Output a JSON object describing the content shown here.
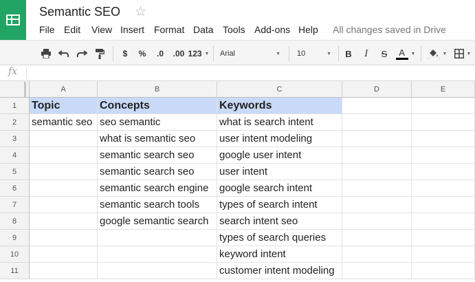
{
  "app": {
    "doc_title": "Semantic SEO",
    "save_status": "All changes saved in Drive",
    "brand_color": "#21a464"
  },
  "menu": [
    "File",
    "Edit",
    "View",
    "Insert",
    "Format",
    "Data",
    "Tools",
    "Add-ons",
    "Help"
  ],
  "toolbar": {
    "currency": "$",
    "percent": "%",
    "decrease_decimals": ".0",
    "increase_decimals": ".00",
    "more_formats": "123",
    "font": "Arial",
    "font_size": "10",
    "bold": "B",
    "italic": "I",
    "strikethrough": "S",
    "text_color_label": "A",
    "text_color": "#000000"
  },
  "formula_bar": {
    "icon_label": "fx",
    "value": ""
  },
  "columns": [
    "A",
    "B",
    "C",
    "D",
    "E"
  ],
  "rows": [
    "1",
    "2",
    "3",
    "4",
    "5",
    "6",
    "7",
    "8",
    "9",
    "10",
    "11"
  ],
  "header_fill": "#c9daf8",
  "cells": [
    [
      "Topic",
      "Concepts",
      "Keywords",
      "",
      ""
    ],
    [
      "semantic seo",
      "seo semantic",
      "what is search intent",
      "",
      ""
    ],
    [
      "",
      "what is semantic seo",
      "user intent modeling",
      "",
      ""
    ],
    [
      "",
      "semantic search seo",
      "google user intent",
      "",
      ""
    ],
    [
      "",
      "semantic search seo",
      "user intent",
      "",
      ""
    ],
    [
      "",
      "semantic search engine",
      "google search intent",
      "",
      ""
    ],
    [
      "",
      "semantic search tools",
      "types of search intent",
      "",
      ""
    ],
    [
      "",
      "google semantic search",
      "search intent seo",
      "",
      ""
    ],
    [
      "",
      "",
      "types of search queries",
      "",
      ""
    ],
    [
      "",
      "",
      "keyword intent",
      "",
      ""
    ],
    [
      "",
      "",
      "customer intent modeling",
      "",
      ""
    ]
  ]
}
